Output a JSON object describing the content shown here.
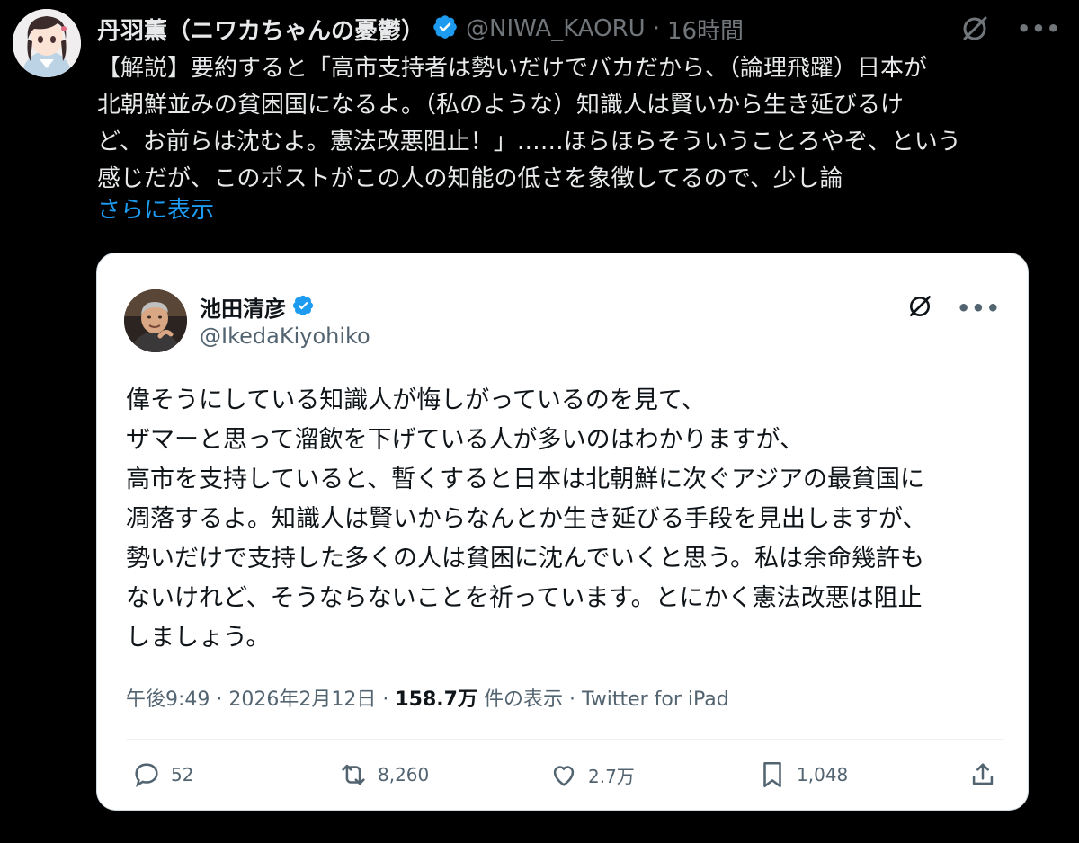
{
  "post": {
    "author_name": "丹羽薫（ニワカちゃんの憂鬱）",
    "handle": "@NIWA_KAORU",
    "separator": "·",
    "time": "16時間",
    "body_lines": [
      "【解説】要約すると「高市支持者は勢いだけでバカだから、（論理飛躍）日本が",
      "北朝鮮並みの貧困国になるよ。（私のような）知識人は賢いから生き延びるけ",
      "ど、お前らは沈むよ。憲法改悪阻止！」……ほらほらそういうことろやぞ、という",
      "感じだが、このポストがこの人の知能の低さを象徴してるので、少し論"
    ],
    "show_more": "さらに表示"
  },
  "quoted": {
    "author_name": "池田清彦",
    "handle": "@IkedaKiyohiko",
    "body_lines": [
      "偉そうにしている知識人が悔しがっているのを見て、",
      "ザマーと思って溜飲を下げている人が多いのはわかりますが、",
      "高市を支持していると、暫くすると日本は北朝鮮に次ぐアジアの最貧国に",
      "凋落するよ。知識人は賢いからなんとか生き延びる手段を見出しますが、",
      "勢いだけで支持した多くの人は貧困に沈んでいくと思う。私は余命幾許も",
      "ないけれど、そうならないことを祈っています。とにかく憲法改悪は阻止",
      "しましょう。"
    ],
    "meta": {
      "time": "午後9:49",
      "dot1": " · ",
      "date": "2026年2月12日",
      "dot2": " · ",
      "views": "158.7万",
      "views_label": " 件の表示",
      "dot3": " · ",
      "source": "Twitter for iPad"
    },
    "stats": {
      "replies": "52",
      "reposts": "8,260",
      "likes": "2.7万",
      "bookmarks": "1,048"
    }
  },
  "icons": [
    "verified-badge-icon",
    "grok-icon",
    "more-icon",
    "reply-icon",
    "repost-icon",
    "like-icon",
    "bookmark-icon",
    "share-icon"
  ],
  "colors": {
    "background": "#000000",
    "accent": "#1d9bf0",
    "muted": "#71767b",
    "card_bg": "#ffffff"
  }
}
